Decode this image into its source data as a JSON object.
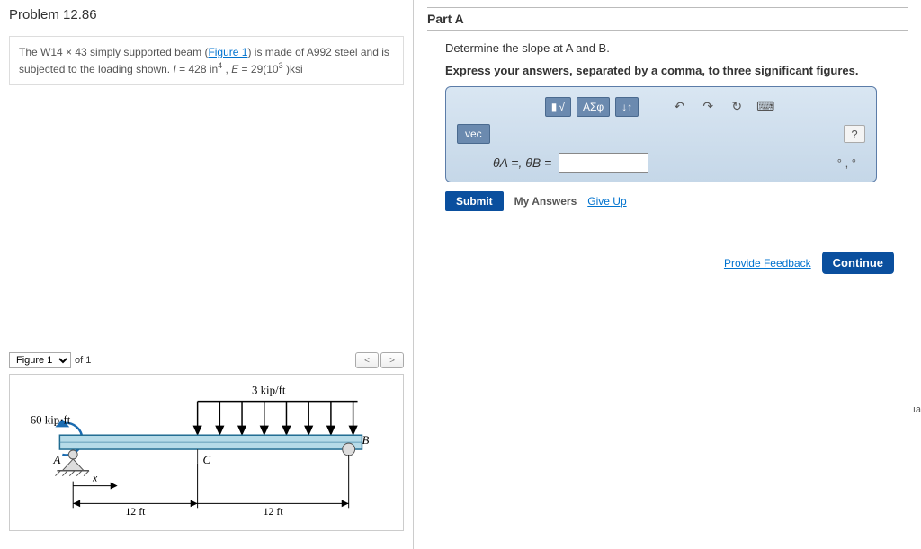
{
  "problem": {
    "title": "Problem 12.86",
    "text_pre": "The W14 × 43 simply supported beam (",
    "figure_link": "Figure 1",
    "text_mid": ") is made of A992 steel and is subjected to the loading shown. ",
    "I_label": "I",
    "I_val": " = 428 in",
    "I_exp": "4",
    "comma": " , ",
    "E_label": "E",
    "E_val": " = 29(10",
    "E_exp": "3",
    "E_unit": " )ksi"
  },
  "figure": {
    "select_label": "Figure 1",
    "of_label": "of 1",
    "prev": "<",
    "next": ">",
    "load_dist": "3 kip/ft",
    "moment": "60 kip·ft",
    "ptA": "A",
    "ptB": "B",
    "ptC": "C",
    "xlabel": "x",
    "span1": "12 ft",
    "span2": "12 ft"
  },
  "partA": {
    "title": "Part A",
    "subtitle": "Determine the slope at A and B.",
    "instruction": "Express your answers, separated by a comma, to three significant figures.",
    "theta_expr": "θA =,  θB =",
    "units": "° , °",
    "vec": "vec",
    "greek": "ΑΣφ",
    "arrows": "↓↑",
    "help": "?",
    "sqrt_label": "√",
    "frac_label": "▮"
  },
  "actions": {
    "submit": "Submit",
    "my_answers": "My Answers",
    "giveup": "Give Up",
    "feedback": "Provide Feedback",
    "continue": "Continue"
  },
  "edge": "ıa"
}
